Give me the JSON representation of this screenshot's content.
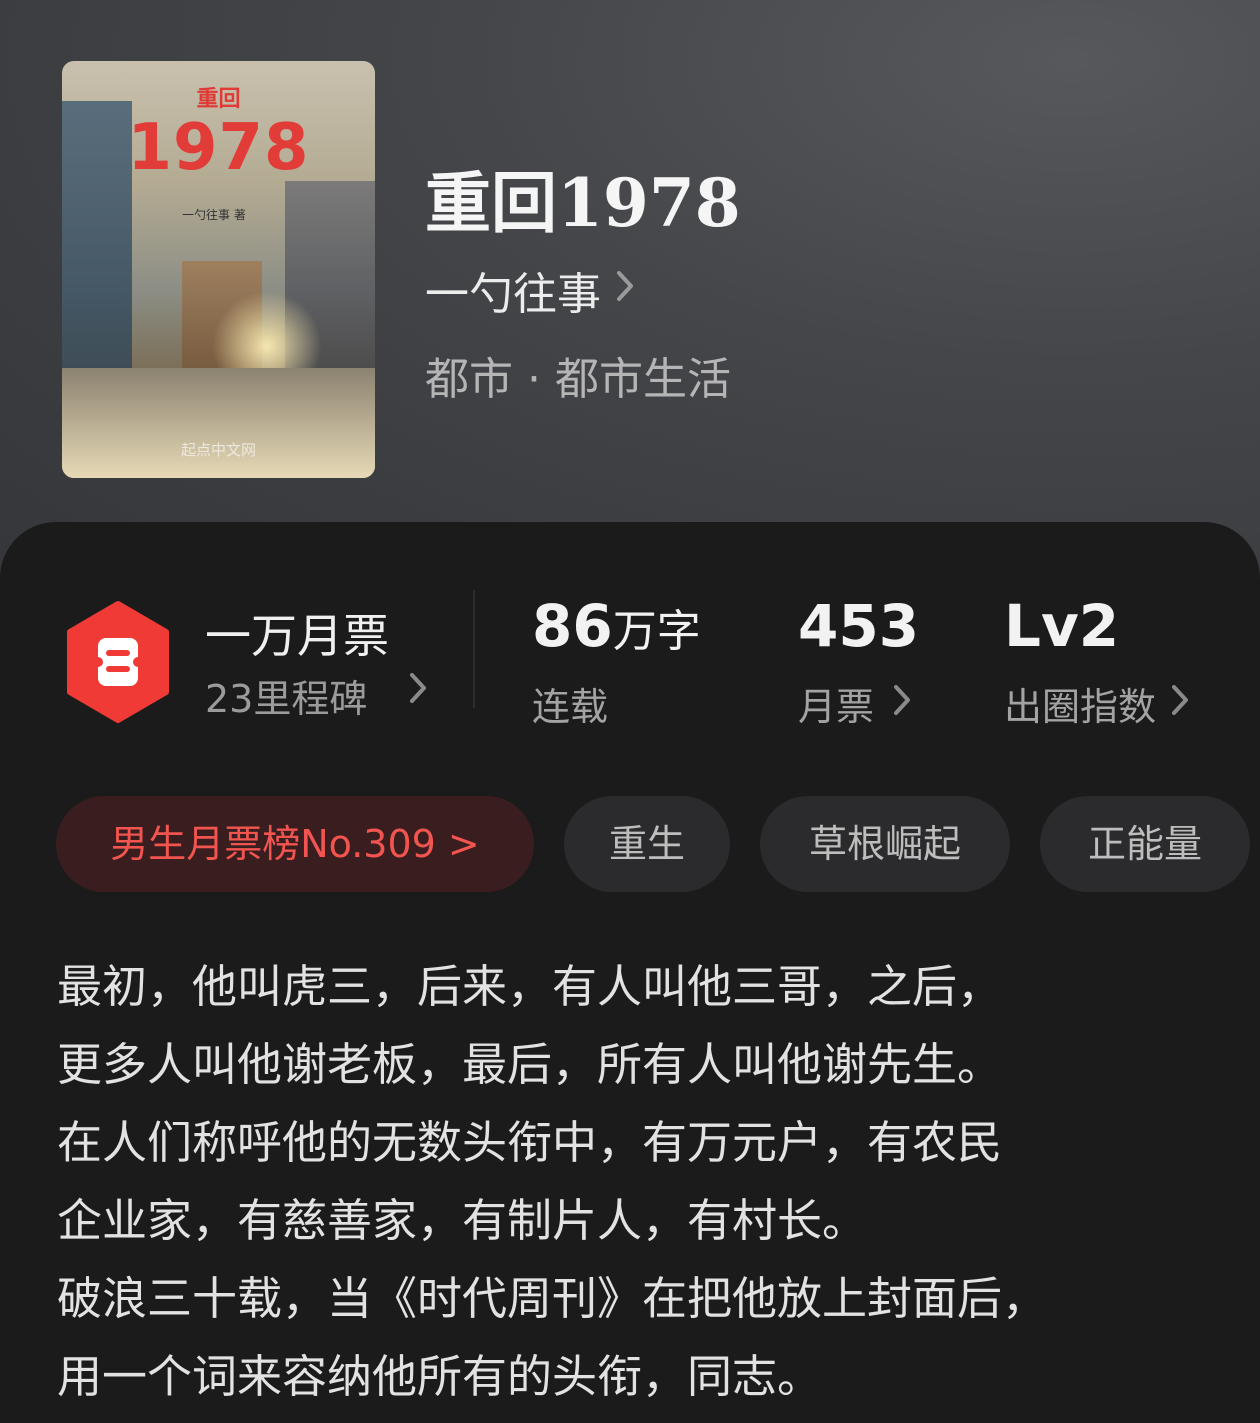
{
  "book": {
    "title": "重回1978",
    "author": "一勺往事",
    "genre": "都市 · 都市生活"
  },
  "cover": {
    "title_small": "重回",
    "title_big": "1978",
    "author_line": "一勺往事 著",
    "publisher": "起点中文网"
  },
  "stats": {
    "ticket_title": "一万月票",
    "ticket_sub": "23里程碑",
    "words_value": "86",
    "words_unit": "万字",
    "words_label": "连载",
    "votes_value": "453",
    "votes_label": "月票",
    "level_value": "Lv2",
    "level_label": "出圈指数"
  },
  "tags": {
    "rank": "男生月票榜No.309 >",
    "tag1": "重生",
    "tag2": "草根崛起",
    "tag3": "正能量"
  },
  "description": [
    "最初，他叫虎三，后来，有人叫他三哥，之后，",
    "更多人叫他谢老板，最后，所有人叫他谢先生。",
    "在人们称呼他的无数头衔中，有万元户，有农民",
    "企业家，有慈善家，有制片人，有村长。",
    "破浪三十载，当《时代周刊》在把他放上封面后，",
    "用一个词来容纳他所有的头衔，同志。"
  ],
  "icons": {
    "chevron": ">",
    "badge_color": "#f03a36"
  }
}
